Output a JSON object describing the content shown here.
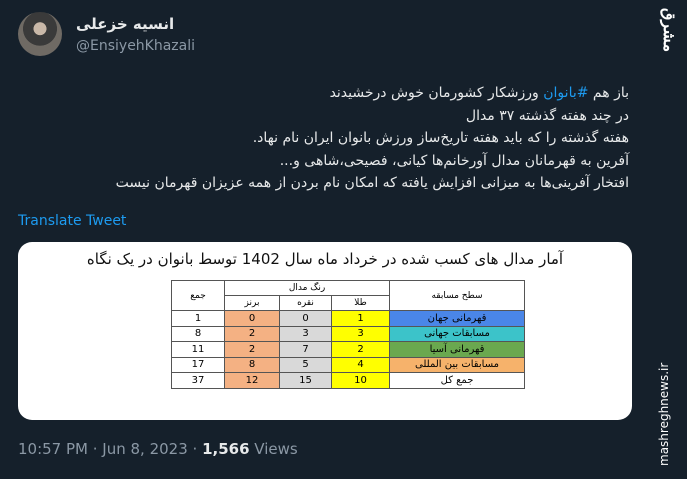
{
  "author": {
    "display_name": "انسیه خزعلی",
    "handle": "@EnsiyehKhazali"
  },
  "watermark": {
    "logo_text": "مشرق",
    "site": "mashreghnews.ir"
  },
  "tweet": {
    "line1_prefix": "باز هم ",
    "line1_hashtag": "#بانوان",
    "line1_suffix": " ورزشکار کشورمان خوش درخشیدند",
    "line2": "در چند هفته گذشته ۳۷ مدال",
    "line3": "هفته گذشته را که باید هفته تاریخ‌ساز ورزش بانوان ایران نام نهاد.",
    "line4": "آفرین به قهرمانان مدال آورخانم‌ها کیانی، فصیحی،شاهی و...",
    "line5": "افتخار آفرینی‌ها به میزانی افزایش یافته که امکان نام بردن از همه عزیزان قهرمان نیست"
  },
  "translate_label": "Translate Tweet",
  "media": {
    "title": "آمار مدال های کسب شده در خرداد ماه سال 1402 توسط بانوان در یک نگاه",
    "table": {
      "header_level": "سطح مسابقه",
      "header_color_group": "رنگ مدال",
      "header_gold": "طلا",
      "header_silver": "نقره",
      "header_bronze": "برنز",
      "header_total": "جمع",
      "rows": [
        {
          "level": "قهرمانی جهان",
          "gold": "1",
          "silver": "0",
          "bronze": "0",
          "total": "1",
          "color": "#4a86e8"
        },
        {
          "level": "مسابقات جهانی",
          "gold": "3",
          "silver": "3",
          "bronze": "2",
          "total": "8",
          "color": "#3cc3c9"
        },
        {
          "level": "قهرمانی آسیا",
          "gold": "2",
          "silver": "7",
          "bronze": "2",
          "total": "11",
          "color": "#6aa84f"
        },
        {
          "level": "مسابقات بین المللی",
          "gold": "4",
          "silver": "5",
          "bronze": "8",
          "total": "17",
          "color": "#f6b26b"
        },
        {
          "level": "جمع کل",
          "gold": "10",
          "silver": "15",
          "bronze": "12",
          "total": "37",
          "color": "#ffffff"
        }
      ]
    }
  },
  "meta": {
    "time": "10:57 PM",
    "sep1": " · ",
    "date": "Jun 8, 2023",
    "sep2": " · ",
    "views_count": "1,566",
    "views_label": " Views"
  }
}
